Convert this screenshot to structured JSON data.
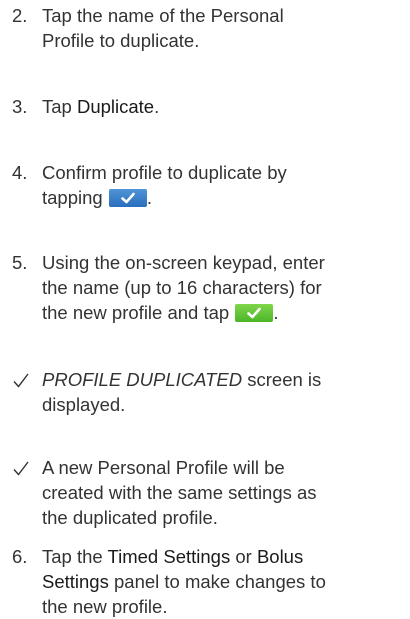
{
  "steps": [
    {
      "number": "2.",
      "line1": "Tap the name of the Personal",
      "line2": "Profile to duplicate."
    },
    {
      "number": "3.",
      "prefix": "Tap ",
      "emphasis": "Duplicate",
      "suffix": "."
    },
    {
      "number": "4.",
      "line1": "Confirm profile to duplicate by",
      "line2_prefix": "tapping",
      "line2_suffix": "."
    },
    {
      "number": "5.",
      "line1": "Using the on-screen keypad, enter",
      "line2": "the name (up to 16 characters) for",
      "line3_prefix": "the new profile and tap",
      "line3_suffix": "."
    },
    {
      "number": "6.",
      "line1_prefix": "Tap the ",
      "line1_em1": "Timed Settings",
      "line1_mid": " or ",
      "line1_em2": "Bolus",
      "line2_em": "Settings",
      "line2_suffix": " panel to make changes to",
      "line3": "the new profile."
    }
  ],
  "results": [
    {
      "line1_em": "PROFILE DUPLICATED",
      "line1_suffix": " screen is",
      "line2": "displayed."
    },
    {
      "line1": "A new Personal Profile will be",
      "line2": "created with the same settings as",
      "line3": "the duplicated profile."
    }
  ],
  "icons": {
    "confirm_button_blue": "checkmark-button-icon",
    "confirm_button_green": "checkmark-button-icon",
    "result_marker": "checkmark-icon"
  },
  "colors": {
    "text": "#333333",
    "blue_button": "#3a7fcb",
    "green_button": "#5cc236"
  }
}
